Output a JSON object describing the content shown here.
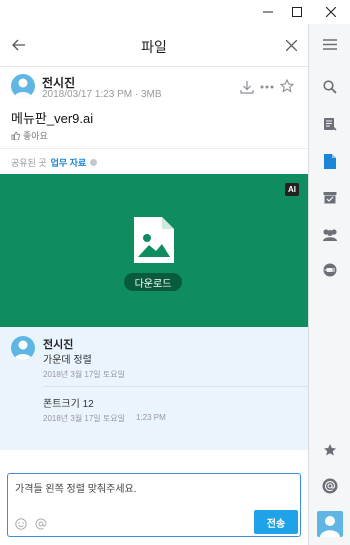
{
  "panel": {
    "title": "파일"
  },
  "file": {
    "author": "전시진",
    "meta": "2018/03/17 1:23 PM · 3MB",
    "name": "메뉴판_ver9.ai",
    "like_label": "좋아요",
    "shared_label": "공유된 곳",
    "shared_topic": "업무 자료",
    "badge": "AI",
    "download_label": "다운로드"
  },
  "comments": {
    "author": "전시진",
    "items": [
      {
        "text": "가운데 정렬",
        "date": "2018년 3월 17일 토요일"
      },
      {
        "text": "폰트크기 12",
        "date": "2018년 3월 17일 토요일",
        "time": "1:23 PM"
      }
    ]
  },
  "composer": {
    "text": "가격들 왼쪽 정렬 맞춰주세요.",
    "send_label": "전송"
  },
  "colors": {
    "preview_bg": "#0f8d5e",
    "accent": "#1fa2e8",
    "link": "#1b86d6",
    "comment_bg": "#eaf4fd"
  },
  "rail": {
    "icons": [
      "menu-icon",
      "search-icon",
      "mention-icon",
      "file-icon",
      "archive-icon",
      "members-icon",
      "integration-icon",
      "star-icon",
      "at-icon",
      "user-avatar"
    ]
  }
}
